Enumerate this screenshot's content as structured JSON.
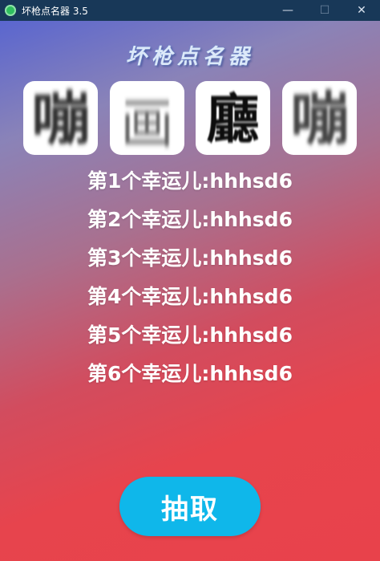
{
  "window": {
    "title": "坏枪点名器 3.5",
    "minimize_glyph": "—",
    "maximize_glyph": "☐",
    "close_glyph": "✕"
  },
  "app": {
    "heading": "坏枪点名器"
  },
  "slots": {
    "chars": [
      "嘣",
      "画",
      "廳",
      "嘣"
    ]
  },
  "winners": [
    "第1个幸运儿:hhhsd6",
    "第2个幸运儿:hhhsd6",
    "第3个幸运儿:hhhsd6",
    "第4个幸运儿:hhhsd6",
    "第5个幸运儿:hhhsd6",
    "第6个幸运儿:hhhsd6"
  ],
  "actions": {
    "draw_label": "抽取"
  },
  "colors": {
    "titlebar": "#183858",
    "gradient_top": "#5a66cf",
    "gradient_bottom": "#e8424b",
    "button": "#0fb7ea"
  }
}
